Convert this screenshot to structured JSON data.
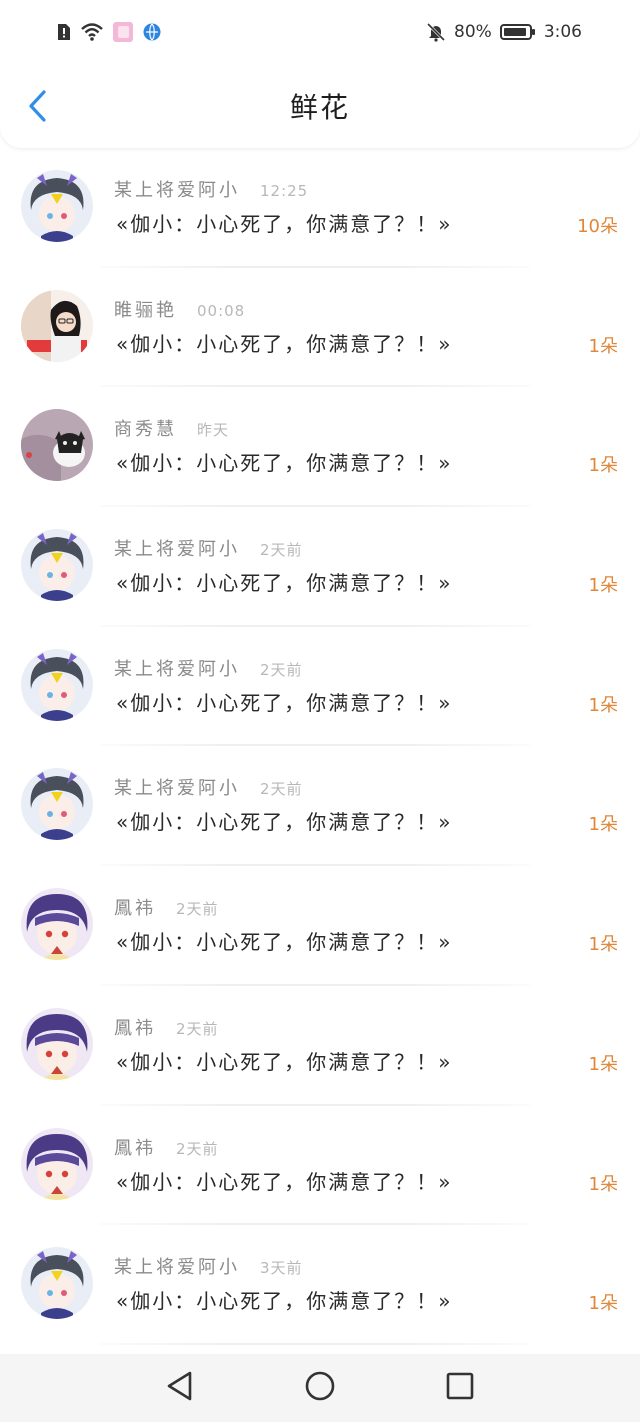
{
  "status_bar": {
    "battery_percent": "80%",
    "time": "3:06",
    "icons": [
      "alert-icon",
      "wifi-icon",
      "app-icon",
      "browser-icon",
      "bell-muted-icon",
      "battery-icon"
    ]
  },
  "header": {
    "title": "鲜花",
    "back_icon": "chevron-left-icon"
  },
  "colors": {
    "accent_blue": "#2f8fe8",
    "flower_count_orange": "#e0873a",
    "name_gray": "#8a8a8a",
    "time_gray": "#b8b8b8"
  },
  "items": [
    {
      "name": "某上将爱阿小",
      "time": "12:25",
      "message": "«伽小：小心死了，你满意了？！»",
      "count": "10朵",
      "avatar": "anime-girl-avatar"
    },
    {
      "name": "睢骊艳",
      "time": "00:08",
      "message": "«伽小：小心死了，你满意了？！»",
      "count": "1朵",
      "avatar": "photo-avatar"
    },
    {
      "name": "商秀慧",
      "time": "昨天",
      "message": "«伽小：小心死了，你满意了？！»",
      "count": "1朵",
      "avatar": "cat-avatar"
    },
    {
      "name": "某上将爱阿小",
      "time": "2天前",
      "message": "«伽小：小心死了，你满意了？！»",
      "count": "1朵",
      "avatar": "anime-girl-avatar"
    },
    {
      "name": "某上将爱阿小",
      "time": "2天前",
      "message": "«伽小：小心死了，你满意了？！»",
      "count": "1朵",
      "avatar": "anime-girl-avatar"
    },
    {
      "name": "某上将爱阿小",
      "time": "2天前",
      "message": "«伽小：小心死了，你满意了？！»",
      "count": "1朵",
      "avatar": "anime-girl-avatar"
    },
    {
      "name": "鳳祎",
      "time": "2天前",
      "message": "«伽小：小心死了，你满意了？！»",
      "count": "1朵",
      "avatar": "anime-boy-avatar"
    },
    {
      "name": "鳳祎",
      "time": "2天前",
      "message": "«伽小：小心死了，你满意了？！»",
      "count": "1朵",
      "avatar": "anime-boy-avatar"
    },
    {
      "name": "鳳祎",
      "time": "2天前",
      "message": "«伽小：小心死了，你满意了？！»",
      "count": "1朵",
      "avatar": "anime-boy-avatar"
    },
    {
      "name": "某上将爱阿小",
      "time": "3天前",
      "message": "«伽小：小心死了，你满意了？！»",
      "count": "1朵",
      "avatar": "anime-girl-avatar"
    }
  ],
  "nav_bar": {
    "icons": [
      "nav-back-icon",
      "nav-home-icon",
      "nav-recents-icon"
    ]
  }
}
